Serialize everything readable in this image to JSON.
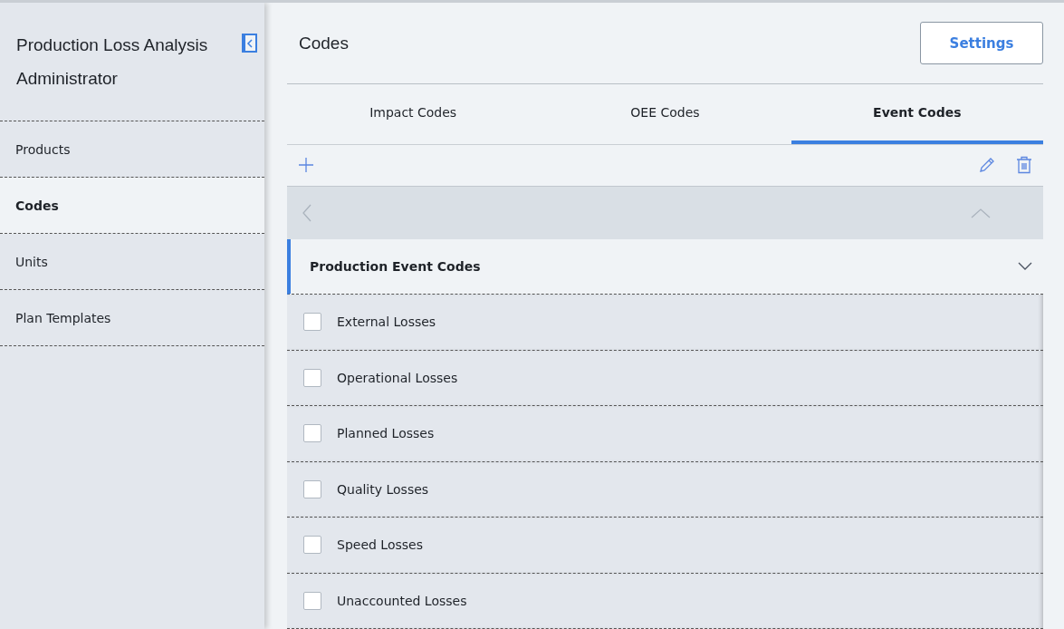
{
  "sidebar": {
    "title": "Production Loss Analysis Administrator",
    "items": [
      {
        "label": "Products",
        "selected": false
      },
      {
        "label": "Codes",
        "selected": true
      },
      {
        "label": "Units",
        "selected": false
      },
      {
        "label": "Plan Templates",
        "selected": false
      }
    ]
  },
  "main": {
    "title": "Codes",
    "settings_button": "Settings",
    "tabs": [
      {
        "label": "Impact Codes",
        "selected": false
      },
      {
        "label": "OEE Codes",
        "selected": false
      },
      {
        "label": "Event Codes",
        "selected": true
      }
    ],
    "group": {
      "title": "Production Event Codes",
      "expanded": true,
      "rows": [
        {
          "label": "External Losses",
          "checked": false
        },
        {
          "label": "Operational Losses",
          "checked": false
        },
        {
          "label": "Planned Losses",
          "checked": false
        },
        {
          "label": "Quality Losses",
          "checked": false
        },
        {
          "label": "Speed Losses",
          "checked": false
        },
        {
          "label": "Unaccounted Losses",
          "checked": false
        }
      ]
    }
  }
}
